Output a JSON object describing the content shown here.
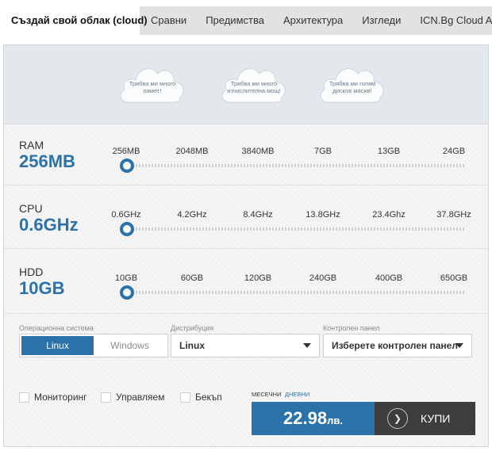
{
  "tabs": [
    {
      "label": "Създай свой облак (cloud)",
      "active": true
    },
    {
      "label": "Сравни"
    },
    {
      "label": "Предимства"
    },
    {
      "label": "Архитектура"
    },
    {
      "label": "Изгледи"
    },
    {
      "label": "ICN.Bg Cloud App"
    }
  ],
  "clouds": [
    {
      "text": "Трябва ми много памет!"
    },
    {
      "text": "Трябва ми много изчислителна мощ!"
    },
    {
      "text": "Трябва ми голям дисков масив!"
    }
  ],
  "sliders": {
    "ram": {
      "label": "RAM",
      "value": "256MB",
      "ticks": [
        "256MB",
        "2048MB",
        "3840MB",
        "7GB",
        "13GB",
        "24GB"
      ],
      "position": 0
    },
    "cpu": {
      "label": "CPU",
      "value": "0.6GHz",
      "ticks": [
        "0.6GHz",
        "4.2GHz",
        "8.4GHz",
        "13.8GHz",
        "23.4Ghz",
        "37.8GHz"
      ],
      "position": 0
    },
    "hdd": {
      "label": "HDD",
      "value": "10GB",
      "ticks": [
        "10GB",
        "60GB",
        "120GB",
        "240GB",
        "400GB",
        "650GB"
      ],
      "position": 0
    }
  },
  "os": {
    "label": "Операционна система",
    "options": [
      "Linux",
      "Windows"
    ],
    "selected": "Linux"
  },
  "distribution": {
    "label": "Дистрибуция",
    "value": "Linux"
  },
  "control_panel": {
    "label": "Контролен панел",
    "value": "Изберете контролен панел"
  },
  "addons": [
    {
      "label": "Мониторинг",
      "checked": false
    },
    {
      "label": "Управляем",
      "checked": false
    },
    {
      "label": "Бекъп",
      "checked": false
    }
  ],
  "billing": {
    "monthly_label": "МЕСЕЧНИ",
    "daily_label": "ДНЕВНИ",
    "price": "22.98",
    "currency": "лв."
  },
  "buy": {
    "label": "КУПИ",
    "icon": "chevron-right-icon"
  },
  "colors": {
    "accent": "#2a72a8",
    "buy_bg": "#3d3d3d",
    "tab_bg": "#e2e2e2"
  }
}
